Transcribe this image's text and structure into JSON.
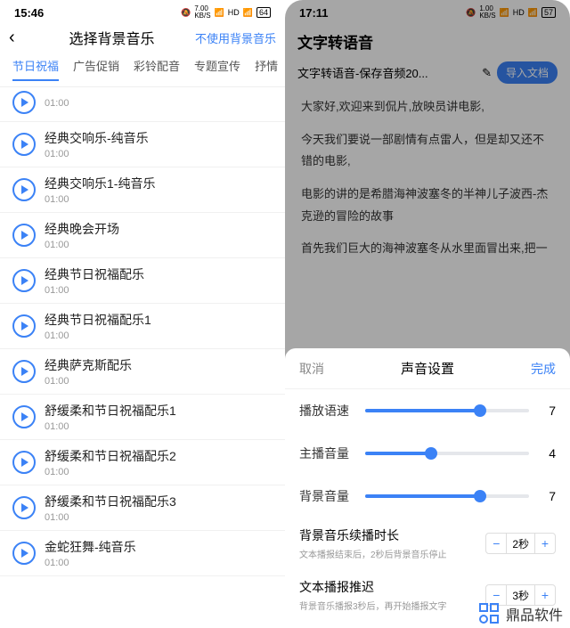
{
  "left": {
    "status": {
      "time": "15:46",
      "net": "7.00",
      "netUnit": "KB/S",
      "battery": "64"
    },
    "header": {
      "title": "选择背景音乐",
      "noMusic": "不使用背景音乐"
    },
    "tabs": [
      "节日祝福",
      "广告促销",
      "彩铃配音",
      "专题宣传",
      "抒情"
    ],
    "activeTab": 0,
    "tracks": [
      {
        "title": "",
        "dur": "01:00"
      },
      {
        "title": "经典交响乐-纯音乐",
        "dur": "01:00"
      },
      {
        "title": "经典交响乐1-纯音乐",
        "dur": "01:00"
      },
      {
        "title": "经典晚会开场",
        "dur": "01:00"
      },
      {
        "title": "经典节日祝福配乐",
        "dur": "01:00"
      },
      {
        "title": "经典节日祝福配乐1",
        "dur": "01:00"
      },
      {
        "title": "经典萨克斯配乐",
        "dur": "01:00"
      },
      {
        "title": "舒缓柔和节日祝福配乐1",
        "dur": "01:00"
      },
      {
        "title": "舒缓柔和节日祝福配乐2",
        "dur": "01:00"
      },
      {
        "title": "舒缓柔和节日祝福配乐3",
        "dur": "01:00"
      },
      {
        "title": "金蛇狂舞-纯音乐",
        "dur": "01:00"
      }
    ]
  },
  "right": {
    "status": {
      "time": "17:11",
      "net": "1.00",
      "netUnit": "KB/S",
      "battery": "57"
    },
    "title": "文字转语音",
    "docName": "文字转语音-保存音频20...",
    "importBtn": "导入文档",
    "paragraphs": [
      "大家好,欢迎来到侃片,放映员讲电影,",
      "今天我们要说一部剧情有点雷人，但是却又还不错的电影,",
      "电影的讲的是希腊海神波塞冬的半神儿子波西-杰克逊的冒险的故事",
      "首先我们巨大的海神波塞冬从水里面冒出来,把一"
    ],
    "sheet": {
      "cancel": "取消",
      "title": "声音设置",
      "done": "完成",
      "sliders": [
        {
          "label": "播放语速",
          "value": 7,
          "max": 10
        },
        {
          "label": "主播音量",
          "value": 4,
          "max": 10
        },
        {
          "label": "背景音量",
          "value": 7,
          "max": 10
        }
      ],
      "settings": [
        {
          "title": "背景音乐续播时长",
          "desc": "文本播报结束后，2秒后背景音乐停止",
          "value": "2秒"
        },
        {
          "title": "文本播报推迟",
          "desc": "背景音乐播报3秒后，再开始播报文字",
          "value": "3秒"
        }
      ]
    }
  },
  "watermark": "鼎品软件"
}
